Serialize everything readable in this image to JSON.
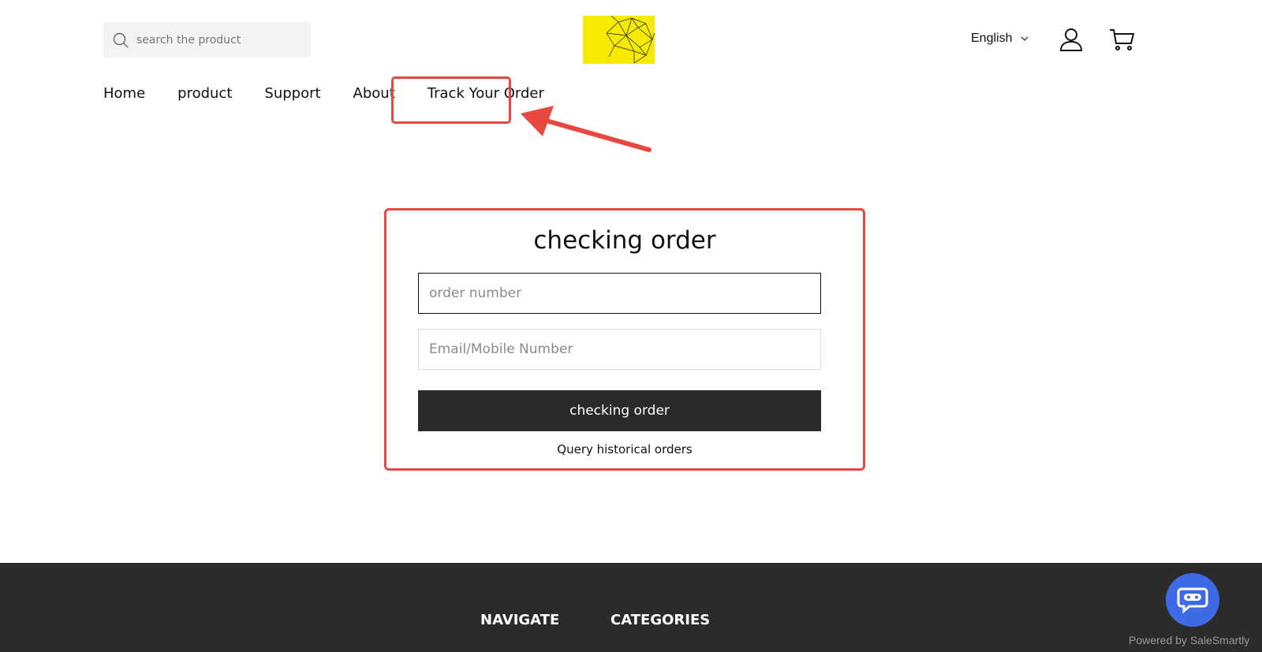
{
  "header": {
    "search": {
      "placeholder": "search the product",
      "icon": "search-icon"
    },
    "language": {
      "label": "English",
      "icon": "chevron-down-icon"
    },
    "user_icon": "user-icon",
    "cart_icon": "cart-icon",
    "logo_colors": {
      "background": "#f5ea00",
      "lines": "#1a1a1a"
    }
  },
  "nav": {
    "items": [
      {
        "label": "Home"
      },
      {
        "label": "product"
      },
      {
        "label": "Support"
      },
      {
        "label": "About"
      },
      {
        "label": "Track Your Order"
      }
    ]
  },
  "annotation": {
    "color": "#e8473f"
  },
  "order_form": {
    "title": "checking order",
    "order_number": {
      "placeholder": "order number",
      "value": ""
    },
    "contact": {
      "placeholder": "Email/Mobile Number",
      "value": ""
    },
    "submit_label": "checking order",
    "history_link": "Query historical orders"
  },
  "footer": {
    "columns": [
      {
        "heading": "NAVIGATE"
      },
      {
        "heading": "CATEGORIES"
      }
    ],
    "background": "#2b2b2b"
  },
  "chat_widget": {
    "icon": "chat-icon",
    "color": "#3f6ae6",
    "powered_by": "Powered by SaleSmartly"
  }
}
